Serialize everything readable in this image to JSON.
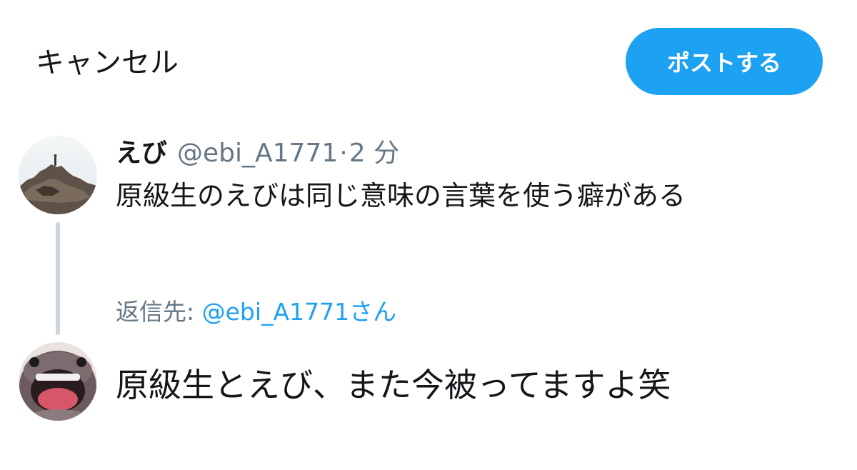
{
  "header": {
    "cancel_label": "キャンセル",
    "post_label": "ポストする"
  },
  "original_tweet": {
    "display_name": "えび",
    "handle": "@ebi_A1771",
    "separator": "·",
    "time": "2 分",
    "text": "原級生のえびは同じ意味の言葉を使う癖がある",
    "avatar_icon": "rocky-coast-photo-avatar"
  },
  "reply": {
    "label": "返信先: ",
    "target": "@ebi_A1771さん",
    "avatar_icon": "smiling-creature-avatar"
  },
  "composer": {
    "text": "原級生とえび、また今被ってますよ笑"
  },
  "colors": {
    "accent": "#1da1f2",
    "text_primary": "#14171a",
    "text_secondary": "#657786",
    "thread_line": "#ccd6dd"
  }
}
